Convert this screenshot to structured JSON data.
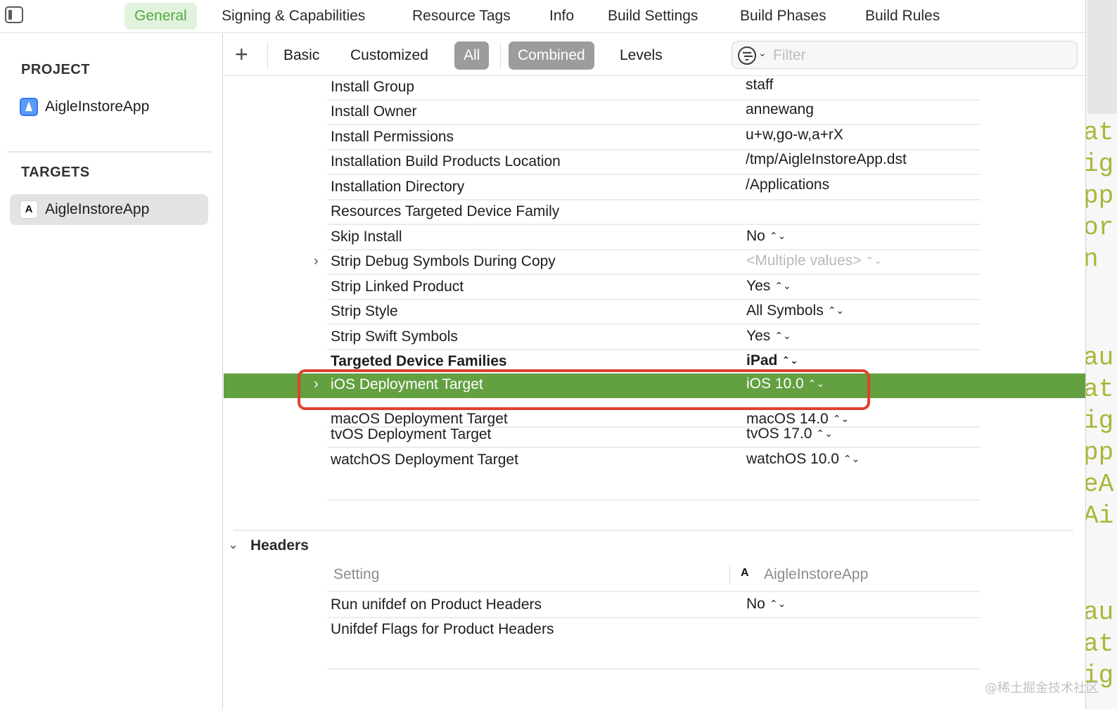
{
  "top_tabs": {
    "general": "General",
    "signing": "Signing & Capabilities",
    "resource_tags": "Resource Tags",
    "info": "Info",
    "build_settings": "Build Settings",
    "build_phases": "Build Phases",
    "build_rules": "Build Rules"
  },
  "sidebar": {
    "project_heading": "PROJECT",
    "project_item": "AigleInstoreApp",
    "targets_heading": "TARGETS",
    "target_item": "AigleInstoreApp",
    "target_icon_glyph": "A"
  },
  "filterbar": {
    "add_symbol": "+",
    "basic": "Basic",
    "customized": "Customized",
    "all": "All",
    "combined": "Combined",
    "levels": "Levels",
    "filter_placeholder": "Filter"
  },
  "settings": {
    "install_group": {
      "name": "Install Group",
      "value": "staff"
    },
    "install_owner": {
      "name": "Install Owner",
      "value": "annewang"
    },
    "install_permissions": {
      "name": "Install Permissions",
      "value": "u+w,go-w,a+rX"
    },
    "install_location": {
      "name": "Installation Build Products Location",
      "value": "/tmp/AigleInstoreApp.dst"
    },
    "install_dir": {
      "name": "Installation Directory",
      "value": "/Applications"
    },
    "resources_family": {
      "name": "Resources Targeted Device Family",
      "value": ""
    },
    "skip_install": {
      "name": "Skip Install",
      "value": "No"
    },
    "strip_debug": {
      "name": "Strip Debug Symbols During Copy",
      "value": "<Multiple values>"
    },
    "strip_linked": {
      "name": "Strip Linked Product",
      "value": "Yes"
    },
    "strip_style": {
      "name": "Strip Style",
      "value": "All Symbols"
    },
    "strip_swift": {
      "name": "Strip Swift Symbols",
      "value": "Yes"
    },
    "targeted_families": {
      "name": "Targeted Device Families",
      "value": "iPad"
    },
    "ios_target": {
      "name": "iOS Deployment Target",
      "value": "iOS 10.0"
    },
    "macos_target": {
      "name": "macOS Deployment Target",
      "value": "macOS 14.0"
    },
    "tvos_target": {
      "name": "tvOS Deployment Target",
      "value": "tvOS 17.0"
    },
    "watchos_target": {
      "name": "watchOS Deployment Target",
      "value": "watchOS 10.0"
    }
  },
  "headers_section": {
    "title": "Headers",
    "column_setting": "Setting",
    "column_target": "AigleInstoreApp",
    "run_unifdef": {
      "name": "Run unifdef on Product Headers",
      "value": "No"
    },
    "unifdef_flags": {
      "name": "Unifdef Flags for Product Headers",
      "value": ""
    }
  },
  "glyphs": {
    "disclosure_closed": "›",
    "disclosure_open": "⌄",
    "updown": "⌃⌄",
    "chevron_down": "⌄"
  },
  "colors": {
    "active_tab_text": "#55a845",
    "active_tab_bg": "#e1f3dc",
    "highlight_row": "#62a040",
    "annotation_box": "#e0412f",
    "pill_bg": "#9c9c9c"
  },
  "code_peek": [
    "at",
    "ig",
    "pp",
    "or",
    "n",
    "au",
    "at",
    "ig",
    "pp",
    "eA",
    "Ai",
    "au",
    "at",
    "ig"
  ],
  "watermark": "@稀土掘金技术社区"
}
